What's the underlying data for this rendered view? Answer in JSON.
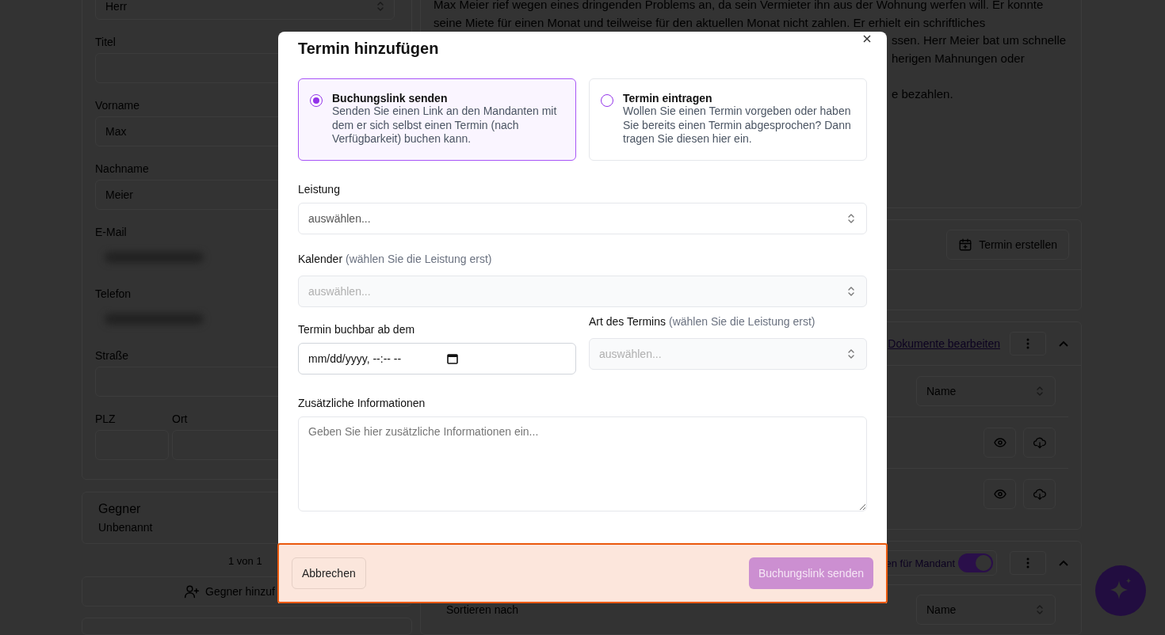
{
  "background": {
    "left": {
      "salutation": "Herr",
      "fields": [
        {
          "label": "Titel",
          "kind": "text"
        },
        {
          "label": "Vorname",
          "kind": "text",
          "value": "Max"
        },
        {
          "label": "Nachname",
          "kind": "text",
          "value": "Meier"
        },
        {
          "label": "E-Mail",
          "kind": "blurred"
        },
        {
          "label": "Telefon",
          "kind": "blurred"
        },
        {
          "label": "Straße",
          "kind": "text"
        }
      ],
      "address_row": [
        {
          "label": "PLZ"
        },
        {
          "label": "Ort"
        }
      ],
      "opponent_card": {
        "title": "Gegner",
        "subtitle": "Unbenannt"
      },
      "pager": "1 von 1",
      "add_opponent_button": "Gegner hinzuf"
    },
    "right": {
      "note_lines": [
        "Max Meier rief wegen eines dringenden Problems an, da sein Vermieter ihn aus der Wohnung werfen will. Er konnte",
        "seine Miete für einen Monat und teilweise für den aktuellen Monat nicht zahlen. Er erhielt ein schriftliches"
      ],
      "note_fragments": [
        "ssen. Herr Meier bat um schnelle",
        "herigen Mahnungen oder",
        "e bezahlen."
      ],
      "appointment_button": "Termin erstellen",
      "documents_link": "Dokumente bearbeiten",
      "documents_sort": "Name",
      "toggle": {
        "label": "en für Mandant",
        "on": true
      },
      "sort_label": "Sortieren nach",
      "sort_value": "Name"
    }
  },
  "modal": {
    "title": "Termin hinzufügen",
    "options": [
      {
        "title": "Buchungslink senden",
        "description": "Senden Sie einen Link an den Mandanten mit dem er sich selbst einen Termin (nach Verfügbarkeit) buchen kann.",
        "selected": true
      },
      {
        "title": "Termin eintragen",
        "description": "Wollen Sie einen Termin vorgeben oder haben Sie bereits einen Termin abgesprochen? Dann tragen Sie diesen hier ein.",
        "selected": false
      }
    ],
    "service": {
      "label": "Leistung",
      "placeholder": "auswählen...",
      "disabled": false
    },
    "calendar": {
      "label": "Kalender",
      "hint": "(wählen Sie die Leistung erst)",
      "placeholder": "auswählen...",
      "disabled": true
    },
    "bookable_from": {
      "label": "Termin buchbar ab dem",
      "value": "mm/dd/yyyy, --:-- --"
    },
    "appointment_type": {
      "label": "Art des Termins",
      "hint": "(wählen Sie die Leistung erst)",
      "placeholder": "auswählen...",
      "disabled": true
    },
    "additional_info": {
      "label": "Zusätzliche Informationen",
      "placeholder": "Geben Sie hier zusätzliche Informationen ein..."
    },
    "cancel_button": "Abbrechen",
    "submit_button": {
      "label": "Buchungslink senden",
      "disabled": true
    }
  }
}
